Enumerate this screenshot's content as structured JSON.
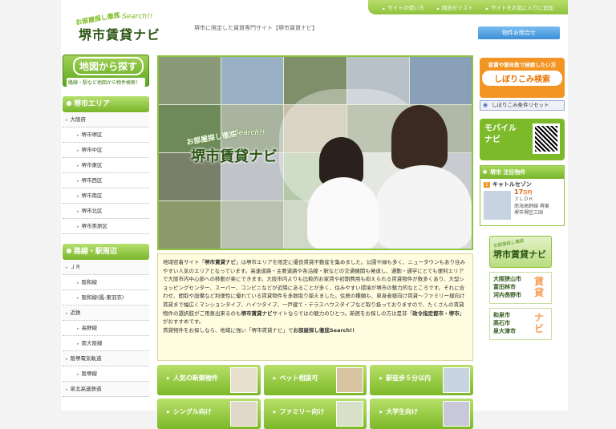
{
  "header": {
    "logo_small": "お部屋探し徹底",
    "logo_search": "Search!!",
    "logo_title": "堺市賃貸ナビ",
    "tagline": "堺市に限定した賃貸専門サイト【堺市賃貸ナビ】",
    "topnav": [
      "サイトの使い方",
      "問合せリスト",
      "サイトをお気に入りに追加"
    ],
    "inquiry_button": "物件お問合せ"
  },
  "left": {
    "map_title": "地図から探す",
    "map_sub": "路線・駅など地図から物件検索！",
    "area_title": "堺市エリア",
    "area_items": [
      {
        "label": "大阪府",
        "sub": false
      },
      {
        "label": "堺市堺区",
        "sub": true
      },
      {
        "label": "堺市中区",
        "sub": true
      },
      {
        "label": "堺市東区",
        "sub": true
      },
      {
        "label": "堺市西区",
        "sub": true
      },
      {
        "label": "堺市南区",
        "sub": true
      },
      {
        "label": "堺市北区",
        "sub": true
      },
      {
        "label": "堺市美原区",
        "sub": true
      }
    ],
    "line_title": "路線・駅周辺",
    "line_items": [
      {
        "label": "ＪＲ",
        "sub": false
      },
      {
        "label": "阪和線",
        "sub": true
      },
      {
        "label": "阪和線(鳳-東羽衣)",
        "sub": true
      },
      {
        "label": "近鉄",
        "sub": false
      },
      {
        "label": "長野線",
        "sub": true
      },
      {
        "label": "南大阪線",
        "sub": true
      },
      {
        "label": "阪堺電気軌道",
        "sub": false
      },
      {
        "label": "阪堺線",
        "sub": true
      },
      {
        "label": "泉北高速鉄道",
        "sub": false
      }
    ]
  },
  "hero": {
    "logo_small": "お部屋探し徹底",
    "logo_search": "Search!!",
    "logo_title": "堺市賃貸ナビ"
  },
  "intro": {
    "p1a": "地域密着サイト「",
    "p1b": "堺市賃貸ナビ",
    "p1c": "」は堺市エリアを限定に優良賃貸不動産を集めました。公園や緑も多く、ニュータウンもあり住みやすい人気のエリアとなっています。高速道路・主要道路や各沿線・駅などの交通機関も発達し、通勤・通学にとても便利エリアで大阪市内中心部への移動が楽にできます。大阪市内よりも比較的お家賃や初期費用も抑えられる賃貸物件が数多くあり、大型ショッピングセンター、スーパー、コンビニなどが近隣にあることが多く、住みやすい環境が堺市の魅力的なところです。それに合わせ、間取や設備など利便性に優れている賃貸物件を多数取り揃えました。住居の種類も、単身者様向け賃貸〜ファミリー様向け賃貸まで幅広くマンションタイプ、ハイツタイプ、一戸建て・テラスハウスタイプなど取り扱っておりますので、たくさんの賃貸物件の選択肢がご用意出来るのも",
    "p1d": "堺市賃貸ナビ",
    "p1e": "サイトならではの魅力のひとつ。新居をお探しの方は是非「",
    "p1f": "政令指定都市・堺市",
    "p1g": "」がおすすめです。",
    "p2a": "賃貸物件をお探しなら、地域に強い「堺市賃貸ナビ」で",
    "p2b": "お部屋探し徹底Search!!"
  },
  "pickup": [
    "人気の新築物件",
    "ペット相談可",
    "駅徒歩５分以内",
    "シングル向け",
    "ファミリー向け",
    "大学生向け"
  ],
  "right": {
    "search_line1": "家賃や築年数で検索したい方",
    "search_line2": "しぼりこみ検索",
    "reset": "しぼりこみ条件リセット",
    "mobile_line1": "モバイル",
    "mobile_line2": "ナビ",
    "recs_title": "堺市 注目物件",
    "rec_rank": "1",
    "rec_name": "キャトルセゾン",
    "rec_price": "17",
    "rec_unit": "万円",
    "rec_layout": "３ＬＤＫ",
    "rec_line": "南海高野線 堺東",
    "rec_addr": "堺市堺区三国",
    "logo2_small": "お部屋探し徹底",
    "logo2_title": "堺市賃貸ナビ",
    "area1": [
      "大阪狭山市",
      "富田林市",
      "河内長野市"
    ],
    "area1_kana": "賃貸",
    "area2": [
      "和泉市",
      "高石市",
      "泉大津市"
    ],
    "area2_kana": "ナビ"
  },
  "colors": {
    "accent": "#8ec33c",
    "orange": "#f39524",
    "blue": "#3b8fd8"
  }
}
